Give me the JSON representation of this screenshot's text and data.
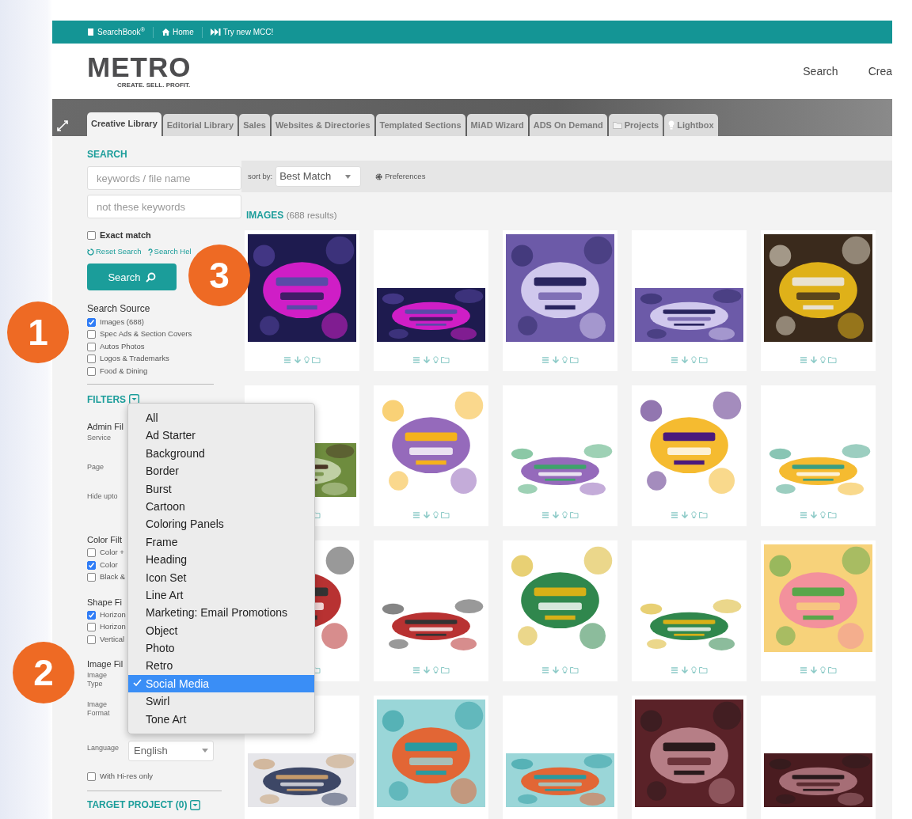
{
  "topbar": {
    "links": [
      {
        "label": "SearchBook$^{®}$"
      },
      {
        "label": "Home"
      },
      {
        "label": "Try new MCC!"
      }
    ]
  },
  "header": {
    "logo": "METRO",
    "tagline": "CREATE. SELL. PROFIT.",
    "nav": [
      "Search",
      "Crea"
    ]
  },
  "tabs": [
    {
      "label": "Creative Library",
      "selected": true
    },
    {
      "label": "Editorial Library",
      "selected": false
    },
    {
      "label": "Sales",
      "selected": false
    },
    {
      "label": "Websites & Directories",
      "selected": false
    },
    {
      "label": "Templated Sections",
      "selected": false
    },
    {
      "label": "MiAD Wizard",
      "selected": false
    },
    {
      "label": "ADS On Demand",
      "selected": false
    },
    {
      "label": "Projects",
      "selected": false
    },
    {
      "label": "Lightbox",
      "selected": false
    }
  ],
  "sidebar": {
    "search_heading": "SEARCH",
    "fields": [
      {
        "placeholder": "keywords / file name"
      },
      {
        "placeholder": "not these keywords"
      }
    ],
    "exact_match": {
      "label": "Exact match",
      "checked": false
    },
    "links": [
      {
        "label": "Reset Search"
      },
      {
        "label": "Search Hel"
      }
    ],
    "search_button": "Search",
    "source": {
      "title": "Search Source",
      "options": [
        {
          "label": "Images (688)",
          "checked": true
        },
        {
          "label": "Spec Ads & Section Covers",
          "checked": false
        },
        {
          "label": "Autos Photos",
          "checked": false
        },
        {
          "label": "Logos & Trademarks",
          "checked": false
        },
        {
          "label": "Food & Dining",
          "checked": false
        }
      ]
    },
    "filters": {
      "title": "FILTERS",
      "items": [
        {
          "kind": "heading",
          "text": "Admin Fil"
        },
        {
          "kind": "label",
          "text": "Service"
        },
        {
          "kind": "label",
          "text": "Page"
        },
        {
          "kind": "label",
          "text": "Hide upto"
        },
        {
          "kind": "heading",
          "text": "Color Filt"
        },
        {
          "kind": "checkbox",
          "text": "Color +",
          "checked": false
        },
        {
          "kind": "checkbox",
          "text": "Color",
          "checked": true
        },
        {
          "kind": "checkbox",
          "text": "Black &",
          "checked": false
        },
        {
          "kind": "heading",
          "text": "Shape Fi"
        },
        {
          "kind": "checkbox",
          "text": "Horizon",
          "checked": true
        },
        {
          "kind": "checkbox",
          "text": "Horizon",
          "checked": false
        },
        {
          "kind": "checkbox",
          "text": "Vertical",
          "checked": false
        },
        {
          "kind": "heading",
          "text": "Image Fil"
        },
        {
          "kind": "label",
          "text": "Image Type"
        },
        {
          "kind": "label",
          "text": "Image Format"
        },
        {
          "kind": "select",
          "text": "Language",
          "value": "English"
        },
        {
          "kind": "checkbox",
          "text": "With Hi-res only",
          "checked": false
        }
      ]
    },
    "target_project": "TARGET PROJECT (0)"
  },
  "dropdown": {
    "options": [
      {
        "label": "All",
        "selected": false
      },
      {
        "label": "Ad Starter",
        "selected": false
      },
      {
        "label": "Background",
        "selected": false
      },
      {
        "label": "Border",
        "selected": false
      },
      {
        "label": "Burst",
        "selected": false
      },
      {
        "label": "Cartoon",
        "selected": false
      },
      {
        "label": "Coloring Panels",
        "selected": false
      },
      {
        "label": "Frame",
        "selected": false
      },
      {
        "label": "Heading",
        "selected": false
      },
      {
        "label": "Icon Set",
        "selected": false
      },
      {
        "label": "Line Art",
        "selected": false
      },
      {
        "label": "Marketing: Email Promotions",
        "selected": false
      },
      {
        "label": "Object",
        "selected": false
      },
      {
        "label": "Photo",
        "selected": false
      },
      {
        "label": "Retro",
        "selected": false
      },
      {
        "label": "Social Media",
        "selected": true
      },
      {
        "label": "Swirl",
        "selected": false
      },
      {
        "label": "Tone Art",
        "selected": false
      }
    ]
  },
  "results": {
    "sort_label": "sort by:",
    "sort_value": "Best Match",
    "preferences": "Preferences",
    "heading": "IMAGES",
    "count": "(688 results)",
    "tiles": [
      {
        "kind": "square"
      },
      {
        "kind": "wide"
      },
      {
        "kind": "square"
      },
      {
        "kind": "wide"
      },
      {
        "kind": "square"
      },
      {
        "kind": "wide"
      },
      {
        "kind": "square"
      },
      {
        "kind": "wide"
      },
      {
        "kind": "square"
      },
      {
        "kind": "wide"
      },
      {
        "kind": "square"
      },
      {
        "kind": "wide"
      },
      {
        "kind": "square"
      },
      {
        "kind": "wide"
      },
      {
        "kind": "square"
      },
      {
        "kind": "wide"
      },
      {
        "kind": "square"
      },
      {
        "kind": "wide"
      },
      {
        "kind": "square"
      },
      {
        "kind": "wide"
      }
    ]
  },
  "callouts": [
    {
      "number": "1"
    },
    {
      "number": "2"
    },
    {
      "number": "3"
    }
  ]
}
